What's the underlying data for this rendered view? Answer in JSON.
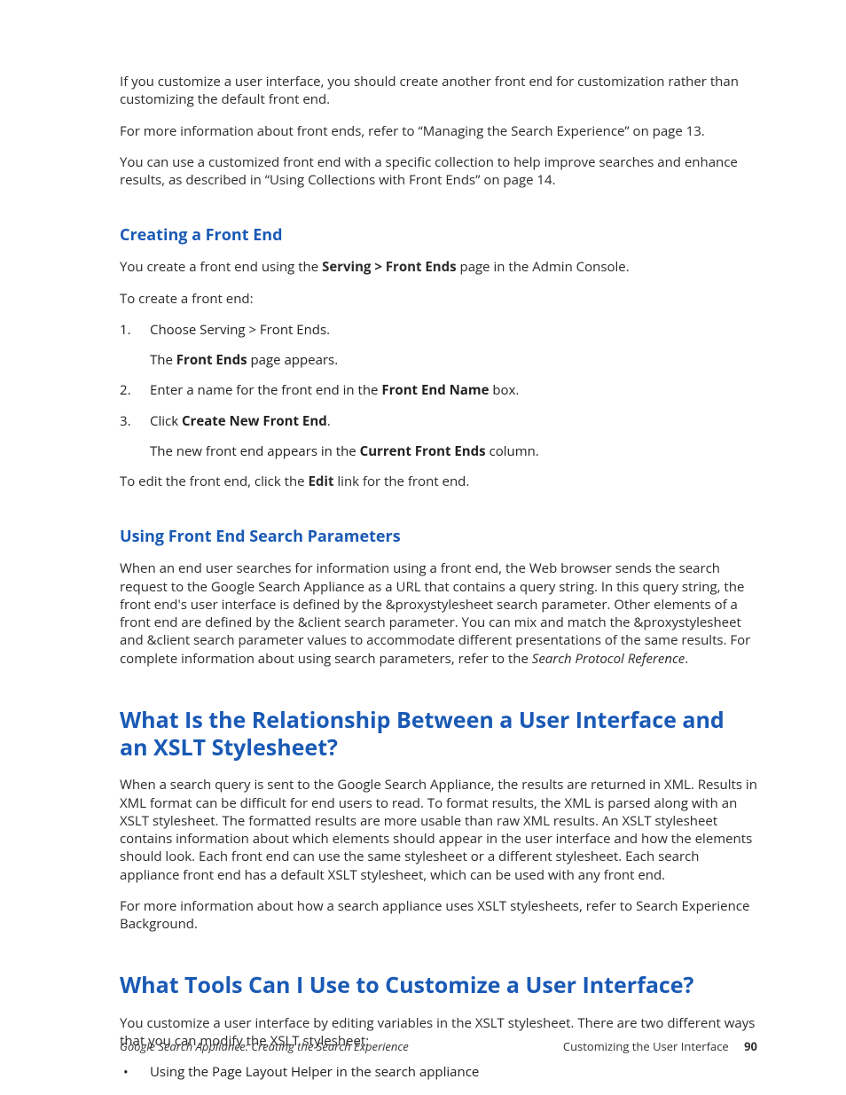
{
  "intro": {
    "p1": "If you customize a user interface, you should create another front end for customization rather than customizing the default front end.",
    "p2": "For more information about front ends, refer to “Managing the Search Experience” on page 13.",
    "p3": "You can use a customized front end with a specific collection to help improve searches and enhance results, as described in “Using Collections with Front Ends” on page 14."
  },
  "creating": {
    "heading": "Creating a Front End",
    "p1_pre": "You create a front end using the ",
    "p1_bold": "Serving > Front Ends",
    "p1_post": " page in the Admin Console.",
    "p2": "To create a front end:",
    "step1": "Choose Serving > Front Ends.",
    "step1_sub_pre": "The ",
    "step1_sub_bold": "Front Ends",
    "step1_sub_post": " page appears.",
    "step2_pre": "Enter a name for the front end in the ",
    "step2_bold": "Front End Name",
    "step2_post": " box.",
    "step3_pre": "Click ",
    "step3_bold": "Create New Front End",
    "step3_post": ".",
    "step3_sub_pre": "The new front end appears in the ",
    "step3_sub_bold": "Current Front Ends",
    "step3_sub_post": " column.",
    "p_after_pre": "To edit the front end, click the ",
    "p_after_bold": "Edit",
    "p_after_post": " link for the front end."
  },
  "using": {
    "heading": "Using Front End Search Parameters",
    "p1_pre": "When an end user searches for information using a front end, the Web browser sends the search request to the Google Search Appliance as a URL that contains a query string. In this query string, the front end's user interface is defined by the &proxystylesheet search parameter. Other elements of a front end are defined by the &client search parameter. You can mix and match the &proxystylesheet and &client search parameter values to accommodate different presentations of the same results. For complete information about using search parameters, refer to the ",
    "p1_italic": "Search Protocol Reference",
    "p1_post": "."
  },
  "relationship": {
    "heading": "What Is the Relationship Between a User Interface and an XSLT Stylesheet?",
    "p1": "When a search query is sent to the Google Search Appliance, the results are returned in XML. Results in XML format can be difficult for end users to read. To format results, the XML is parsed along with an XSLT stylesheet. The formatted results are more usable than raw XML results. An XSLT stylesheet contains information about which elements should appear in the user interface and how the elements should look. Each front end can use the same stylesheet or a different stylesheet. Each search appliance front end has a default XSLT stylesheet, which can be used with any front end.",
    "p2": "For more information about how a search appliance uses XSLT stylesheets, refer to Search Experience Background."
  },
  "tools": {
    "heading": "What Tools Can I Use to Customize a User Interface?",
    "p1": "You customize a user interface by editing variables in the XSLT stylesheet. There are two different ways that you can modify the XSLT stylesheet:",
    "bullet1": "Using the Page Layout Helper in the search appliance"
  },
  "footer": {
    "left": "Google Search Appliance: Creating the Search Experience",
    "right_text": "Customizing the User Interface",
    "page": "90"
  }
}
